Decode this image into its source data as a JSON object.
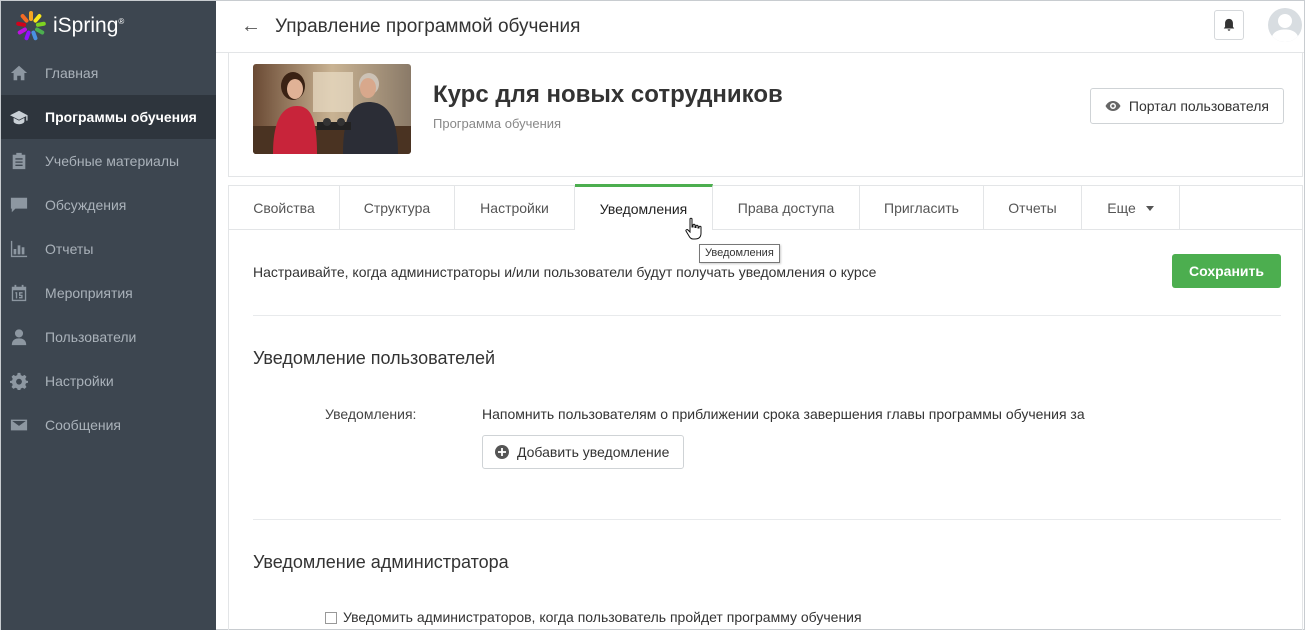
{
  "logo": {
    "text": "iSpring",
    "mark": "®"
  },
  "sidebar": {
    "items": [
      {
        "label": "Главная",
        "icon": "home-icon"
      },
      {
        "label": "Программы обучения",
        "icon": "graduation-cap-icon",
        "active": true
      },
      {
        "label": "Учебные материалы",
        "icon": "clipboard-icon"
      },
      {
        "label": "Обсуждения",
        "icon": "chat-icon"
      },
      {
        "label": "Отчеты",
        "icon": "bar-chart-icon"
      },
      {
        "label": "Мероприятия",
        "icon": "calendar-icon"
      },
      {
        "label": "Пользователи",
        "icon": "user-icon"
      },
      {
        "label": "Настройки",
        "icon": "gear-icon"
      },
      {
        "label": "Сообщения",
        "icon": "envelope-icon"
      }
    ]
  },
  "header": {
    "back_glyph": "←",
    "title": "Управление программой обучения"
  },
  "course": {
    "title": "Курс для новых сотрудников",
    "subtitle": "Программа обучения",
    "portal_button": "Портал пользователя"
  },
  "tabs": [
    {
      "label": "Свойства"
    },
    {
      "label": "Структура"
    },
    {
      "label": "Настройки"
    },
    {
      "label": "Уведомления",
      "active": true
    },
    {
      "label": "Права доступа"
    },
    {
      "label": "Пригласить"
    },
    {
      "label": "Отчеты"
    },
    {
      "label": "Еще"
    }
  ],
  "tooltip": "Уведомления",
  "notifications": {
    "description": "Настраивайте, когда администраторы и/или пользователи будут получать уведомления о курсе",
    "save_button": "Сохранить",
    "user_section": {
      "title": "Уведомление пользователей",
      "field_label": "Уведомления:",
      "field_text": "Напомнить пользователям о приближении срока завершения главы программы обучения за",
      "add_button": "Добавить уведомление"
    },
    "admin_section": {
      "title": "Уведомление администратора",
      "checkbox_label": "Уведомить администраторов, когда пользователь пройдет программу обучения",
      "checkbox_checked": false
    }
  },
  "colors": {
    "sidebar_bg": "#3d4650",
    "sidebar_active_bg": "#2e353d",
    "accent_green": "#4cae4f"
  }
}
